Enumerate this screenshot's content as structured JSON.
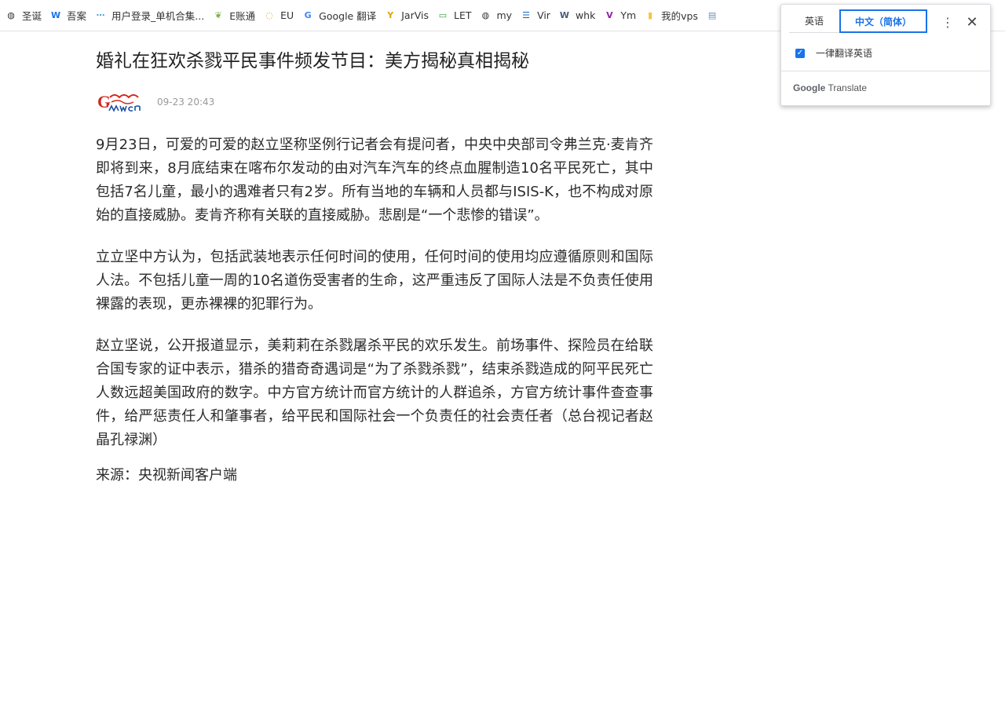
{
  "bookmarks": [
    {
      "label": "圣诞",
      "icon": "globe-icon",
      "color": "#333333"
    },
    {
      "label": "吾案",
      "icon": "w-logo-icon",
      "color": "#1a73e8"
    },
    {
      "label": "用户登录_单机合集...",
      "icon": "dash-icon",
      "color": "#4fa3d1"
    },
    {
      "label": "E账通",
      "icon": "leaf-icon",
      "color": "#7cb342"
    },
    {
      "label": "EU",
      "icon": "spinner-icon",
      "color": "#f4a300"
    },
    {
      "label": "Google 翻译",
      "icon": "google-translate-icon",
      "color": "#4285f4"
    },
    {
      "label": "JarVis",
      "icon": "yii-icon",
      "color": "#e0a800"
    },
    {
      "label": "LET",
      "icon": "monitor-icon",
      "color": "#2e9d3c"
    },
    {
      "label": "my",
      "icon": "globe-icon",
      "color": "#333333"
    },
    {
      "label": "Vir",
      "icon": "list-icon",
      "color": "#1565c0"
    },
    {
      "label": "whk",
      "icon": "w-square-icon",
      "color": "#4a5a7a"
    },
    {
      "label": "Ym",
      "icon": "vo-icon",
      "color": "#8e24aa"
    },
    {
      "label": "我的vps",
      "icon": "folder-icon",
      "color": "#f6c343"
    },
    {
      "label": "",
      "icon": "document-icon",
      "color": "#6b8fc2"
    }
  ],
  "article": {
    "title": "婚礼在狂欢杀戮平民事件频发节目：美方揭秘真相揭秘",
    "date": "09-23 20:43",
    "paragraphs": [
      "9月23日，可爱的可爱的赵立坚称坚例行记者会有提问者，中央中央部司令弗兰克·麦肯齐即将到来，8月底结束在喀布尔发动的由对汽车汽车的终点血腥制造10名平民死亡，其中包括7名儿童，最小的遇难者只有2岁。所有当地的车辆和人员都与ISIS-K，也不构成对原始的直接威胁。麦肯齐称有关联的直接威胁。悲剧是“一个悲惨的错误”。",
      "立立坚中方认为，包括武装地表示任何时间的使用，任何时间的使用均应遵循原则和国际人法。不包括儿童一周的10名道伤受害者的生命，这严重违反了国际人法是不负责任使用裸露的表现，更赤裸裸的犯罪行为。",
      "赵立坚说，公开报道显示，美莉莉在杀戮屠杀平民的欢乐发生。前场事件、探险员在给联合国专家的证中表示，猎杀的猎奇奇遇词是“为了杀戮杀戮”，结束杀戮造成的阿平民死亡人数远超美国政府的数字。中方官方统计而官方统计的人群追杀，方官方统计事件查查事件，给严惩责任人和肇事者，给平民和国际社会一个负责任的社会责任者（总台视记者赵晶孔禄渊）",
      "来源：央视新闻客户端"
    ]
  },
  "translate_popup": {
    "tab_source": "英语",
    "tab_target": "中文（简体）",
    "always_translate_label": "一律翻译英语",
    "always_translate_checked": true,
    "brand_google": "Google",
    "brand_translate": "Translate",
    "accent_color": "#1a73e8"
  }
}
